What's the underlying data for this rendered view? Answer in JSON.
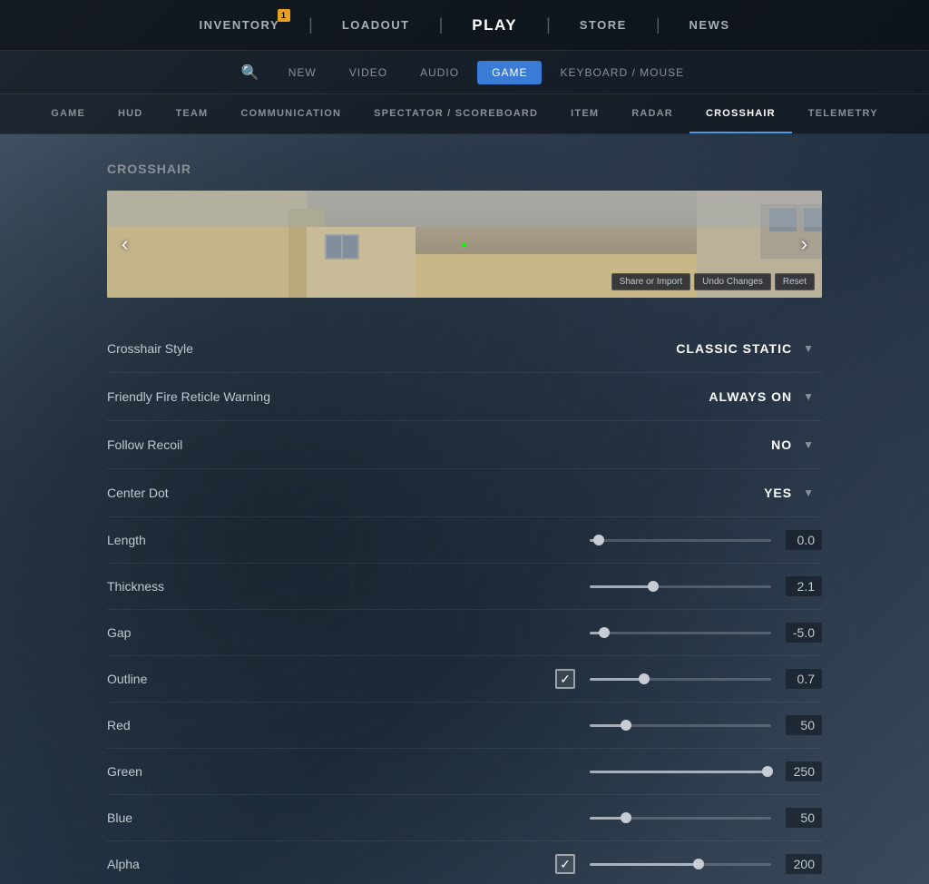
{
  "topNav": {
    "items": [
      {
        "label": "INVENTORY",
        "active": false,
        "badge": "1"
      },
      {
        "label": "LOADOUT",
        "active": false,
        "badge": null
      },
      {
        "label": "PLAY",
        "active": true,
        "badge": null
      },
      {
        "label": "STORE",
        "active": false,
        "badge": null
      },
      {
        "label": "NEWS",
        "active": false,
        "badge": null
      }
    ]
  },
  "settingsNav": {
    "search_placeholder": "Search settings",
    "items": [
      {
        "label": "NEW",
        "active": false
      },
      {
        "label": "VIDEO",
        "active": false
      },
      {
        "label": "AUDIO",
        "active": false
      },
      {
        "label": "GAME",
        "active": true
      },
      {
        "label": "KEYBOARD / MOUSE",
        "active": false
      }
    ]
  },
  "subNav": {
    "items": [
      {
        "label": "GAME",
        "active": false
      },
      {
        "label": "HUD",
        "active": false
      },
      {
        "label": "TEAM",
        "active": false
      },
      {
        "label": "COMMUNICATION",
        "active": false
      },
      {
        "label": "SPECTATOR / SCOREBOARD",
        "active": false
      },
      {
        "label": "ITEM",
        "active": false
      },
      {
        "label": "RADAR",
        "active": false
      },
      {
        "label": "CROSSHAIR",
        "active": true
      },
      {
        "label": "TELEMETRY",
        "active": false
      }
    ]
  },
  "crosshair": {
    "section_title": "Crosshair",
    "preview_btns": {
      "share_or_import": "Share or Import",
      "undo_changes": "Undo Changes",
      "reset": "Reset"
    },
    "settings": [
      {
        "label": "Crosshair Style",
        "type": "dropdown",
        "value": "CLASSIC STATIC"
      },
      {
        "label": "Friendly Fire Reticle Warning",
        "type": "dropdown",
        "value": "ALWAYS ON"
      },
      {
        "label": "Follow Recoil",
        "type": "dropdown",
        "value": "NO"
      },
      {
        "label": "Center Dot",
        "type": "dropdown",
        "value": "YES"
      },
      {
        "label": "Length",
        "type": "slider",
        "value": "0.0",
        "fill_pct": 5,
        "thumb_pct": 5,
        "has_checkbox": false
      },
      {
        "label": "Thickness",
        "type": "slider",
        "value": "2.1",
        "fill_pct": 35,
        "thumb_pct": 35,
        "has_checkbox": false
      },
      {
        "label": "Gap",
        "type": "slider",
        "value": "-5.0",
        "fill_pct": 8,
        "thumb_pct": 8,
        "has_checkbox": false
      },
      {
        "label": "Outline",
        "type": "slider",
        "value": "0.7",
        "fill_pct": 30,
        "thumb_pct": 30,
        "has_checkbox": true,
        "checked": true
      },
      {
        "label": "Red",
        "type": "slider",
        "value": "50",
        "fill_pct": 20,
        "thumb_pct": 20,
        "has_checkbox": false
      },
      {
        "label": "Green",
        "type": "slider",
        "value": "250",
        "fill_pct": 98,
        "thumb_pct": 98,
        "has_checkbox": false
      },
      {
        "label": "Blue",
        "type": "slider",
        "value": "50",
        "fill_pct": 20,
        "thumb_pct": 20,
        "has_checkbox": false
      },
      {
        "label": "Alpha",
        "type": "slider",
        "value": "200",
        "fill_pct": 60,
        "thumb_pct": 60,
        "has_checkbox": true,
        "checked": true
      }
    ]
  }
}
